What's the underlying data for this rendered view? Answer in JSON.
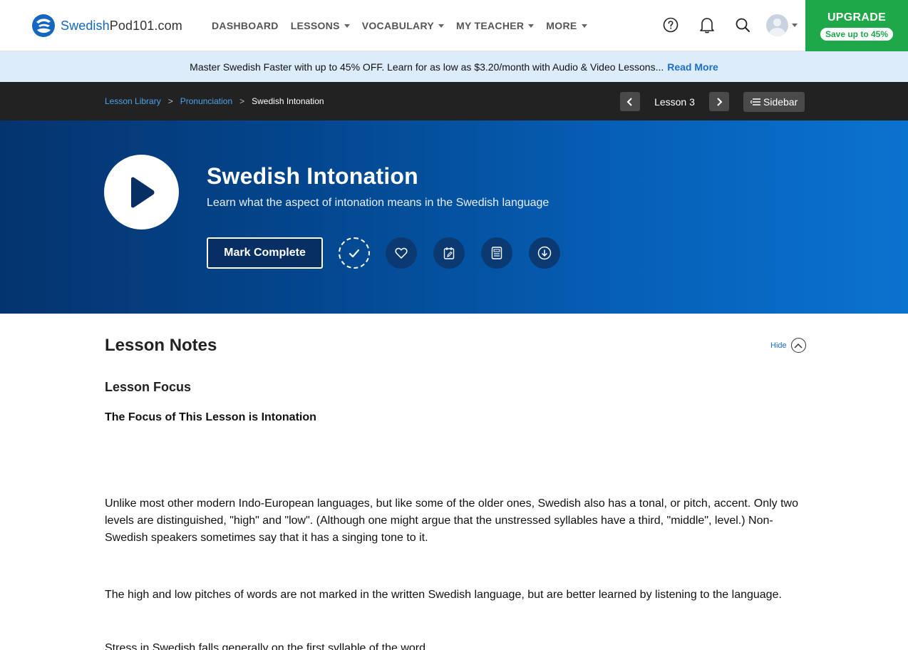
{
  "nav": {
    "logo_brand": "Swedish",
    "logo_rest": "Pod101.com",
    "items": [
      {
        "label": "DASHBOARD",
        "caret": false
      },
      {
        "label": "LESSONS",
        "caret": true
      },
      {
        "label": "VOCABULARY",
        "caret": true
      },
      {
        "label": "MY TEACHER",
        "caret": true
      },
      {
        "label": "MORE",
        "caret": true
      }
    ],
    "upgrade_title": "UPGRADE",
    "upgrade_save": "Save up to 45%"
  },
  "promo": {
    "text": "Master Swedish Faster with up to 45% OFF. Learn for as low as $3.20/month with Audio & Video Lessons...",
    "link": "Read More"
  },
  "breadcrumb": {
    "items": [
      "Lesson Library",
      "Pronunciation"
    ],
    "current": "Swedish Intonation",
    "lesson_label": "Lesson 3",
    "sidebar_label": "Sidebar"
  },
  "hero": {
    "title": "Swedish Intonation",
    "subtitle": "Learn what the aspect of intonation means in the Swedish language",
    "mark_complete": "Mark Complete"
  },
  "content": {
    "section_title": "Lesson Notes",
    "hide_label": "Hide",
    "focus_heading": "Lesson Focus",
    "focus_subheading": "The Focus of This Lesson is Intonation",
    "paragraphs": [
      "Unlike most other modern Indo-European languages, but like some of the older ones, Swedish also has a tonal, or pitch, accent. Only two levels are distinguished, \"high\" and \"low\". (Although one might argue that the unstressed syllables have a third, \"middle\", level.) Non-Swedish speakers sometimes say that it has a singing tone to it.",
      "The high and low pitches of words are not marked in the written Swedish language, but are better learned by listening to the language.",
      "Stress in Swedish falls generally on the first syllable of the word."
    ]
  },
  "colors": {
    "brand_blue": "#1466c0",
    "upgrade_green": "#1fa84a",
    "promo_bg": "#dcecfa",
    "crumb_bar": "#222222",
    "link_blue": "#1a6fd0"
  }
}
